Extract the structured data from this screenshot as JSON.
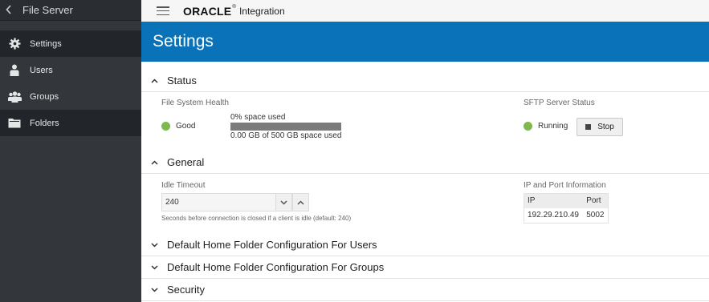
{
  "sidebar": {
    "title": "File Server",
    "items": [
      {
        "label": "Settings",
        "icon": "gear-icon"
      },
      {
        "label": "Users",
        "icon": "user-icon"
      },
      {
        "label": "Groups",
        "icon": "group-icon"
      },
      {
        "label": "Folders",
        "icon": "folder-icon"
      }
    ]
  },
  "topbar": {
    "logo": "ORACLE",
    "product": "Integration"
  },
  "page_title": "Settings",
  "sections": {
    "status": {
      "title": "Status",
      "fs_health_label": "File System Health",
      "fs_health_value": "Good",
      "space_pct_text": "0% space used",
      "space_used_fraction": 0.0,
      "space_detail": "0.00 GB of 500 GB space used",
      "sftp_label": "SFTP Server Status",
      "sftp_value": "Running",
      "stop_label": "Stop"
    },
    "general": {
      "title": "General",
      "idle_label": "Idle Timeout",
      "idle_value": "240",
      "idle_hint": "Seconds before connection is closed if a client is idle (default: 240)",
      "ip_port_label": "IP and Port Information",
      "ip_header": "IP",
      "port_header": "Port",
      "ip_value": "192.29.210.49",
      "port_value": "5002"
    },
    "home_users": {
      "title": "Default Home Folder Configuration For Users"
    },
    "home_groups": {
      "title": "Default Home Folder Configuration For Groups"
    },
    "security": {
      "title": "Security"
    }
  },
  "colors": {
    "banner": "#0a72b8",
    "sidebar": "#33373b",
    "status_ok": "#7cba50"
  }
}
